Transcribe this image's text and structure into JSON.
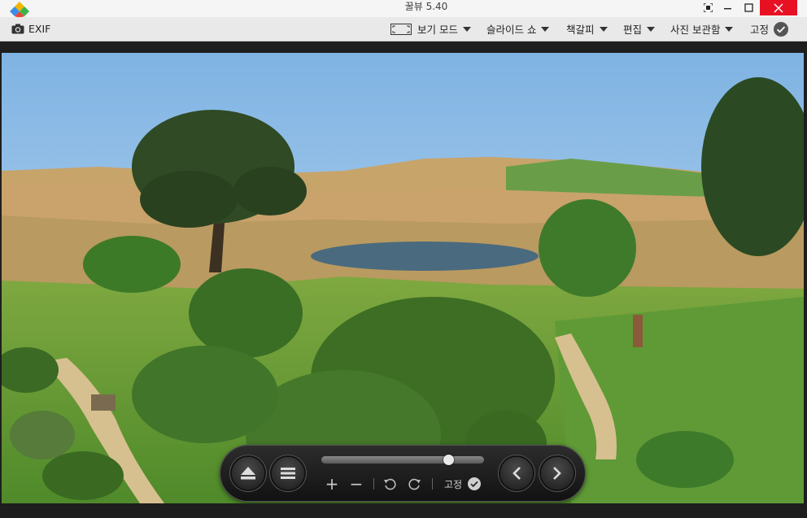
{
  "window": {
    "title": "꿀뷰 5.40",
    "buttons": [
      "fullscreen-toggle",
      "minimize",
      "maximize",
      "close"
    ]
  },
  "toolbar": {
    "exif_label": "EXIF",
    "view_mode_label": "보기 모드",
    "slideshow_label": "슬라이드 쇼",
    "bookmark_label": "책갈피",
    "edit_label": "편집",
    "photo_storage_label": "사진 보관함",
    "pin_label": "고정"
  },
  "viewer": {
    "image_subject": "landscape-photo",
    "controls": {
      "eject_icon": "eject-icon",
      "menu_icon": "menu-icon",
      "zoom_in": "+",
      "zoom_out": "−",
      "rotate_left_icon": "rotate-left-icon",
      "rotate_right_icon": "rotate-right-icon",
      "pin_label": "고정",
      "slider_position": 0.8,
      "prev_icon": "chevron-left-icon",
      "next_icon": "chevron-right-icon"
    }
  },
  "colors": {
    "titlebar": "#f5f5f5",
    "toolbar": "#e9e9e9",
    "close_hover": "#e81123",
    "frame": "#1e1e1e",
    "sky": "#a9cff0"
  }
}
